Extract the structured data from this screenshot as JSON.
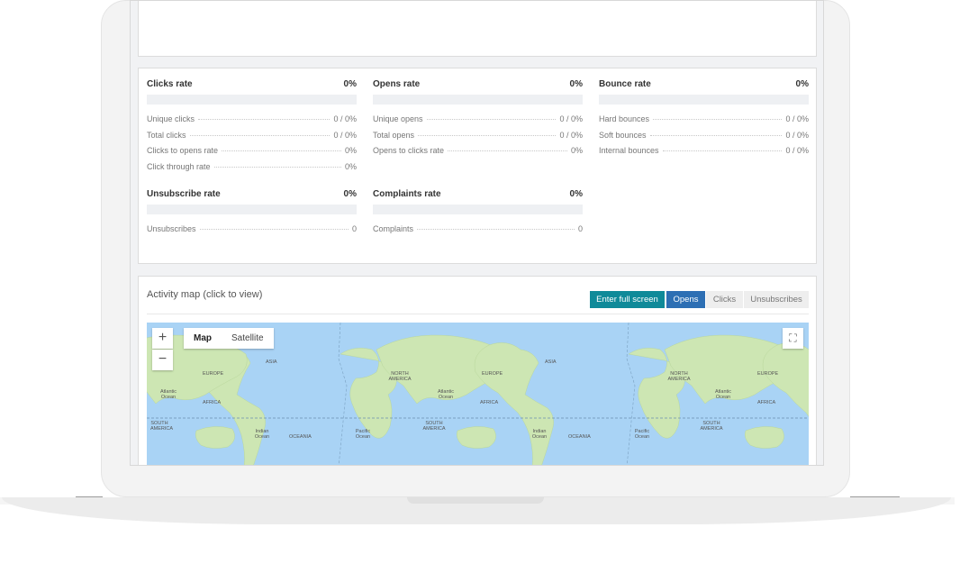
{
  "stats": {
    "clicks": {
      "title": "Clicks rate",
      "pct": "0%",
      "rows": [
        {
          "label": "Unique clicks",
          "value": "0 / 0%"
        },
        {
          "label": "Total clicks",
          "value": "0 / 0%"
        },
        {
          "label": "Clicks to opens rate",
          "value": "0%"
        },
        {
          "label": "Click through rate",
          "value": "0%"
        }
      ]
    },
    "opens": {
      "title": "Opens rate",
      "pct": "0%",
      "rows": [
        {
          "label": "Unique opens",
          "value": "0 / 0%"
        },
        {
          "label": "Total opens",
          "value": "0 / 0%"
        },
        {
          "label": "Opens to clicks rate",
          "value": "0%"
        }
      ]
    },
    "bounce": {
      "title": "Bounce rate",
      "pct": "0%",
      "rows": [
        {
          "label": "Hard bounces",
          "value": "0 / 0%"
        },
        {
          "label": "Soft bounces",
          "value": "0 / 0%"
        },
        {
          "label": "Internal bounces",
          "value": "0 / 0%"
        }
      ]
    },
    "unsubscribe": {
      "title": "Unsubscribe rate",
      "pct": "0%",
      "rows": [
        {
          "label": "Unsubscribes",
          "value": "0"
        }
      ]
    },
    "complaints": {
      "title": "Complaints rate",
      "pct": "0%",
      "rows": [
        {
          "label": "Complaints",
          "value": "0"
        }
      ]
    }
  },
  "activity": {
    "title": "Activity map (click to view)",
    "buttons": {
      "fullscreen": "Enter full screen",
      "opens": "Opens",
      "clicks": "Clicks",
      "unsubscribes": "Unsubscribes"
    }
  },
  "map": {
    "zoom_in": "+",
    "zoom_out": "−",
    "type_map": "Map",
    "type_satellite": "Satellite",
    "labels": [
      "ASIA",
      "EUROPE",
      "AFRICA",
      "NORTH AMERICA",
      "SOUTH AMERICA",
      "OCEANIA",
      "Atlantic Ocean",
      "Indian Ocean",
      "Pacific Ocean"
    ]
  },
  "colors": {
    "teal": "#0f8a99",
    "blue": "#2d6fb4",
    "water": "#a9d3f5",
    "land": "#cde6b3"
  }
}
